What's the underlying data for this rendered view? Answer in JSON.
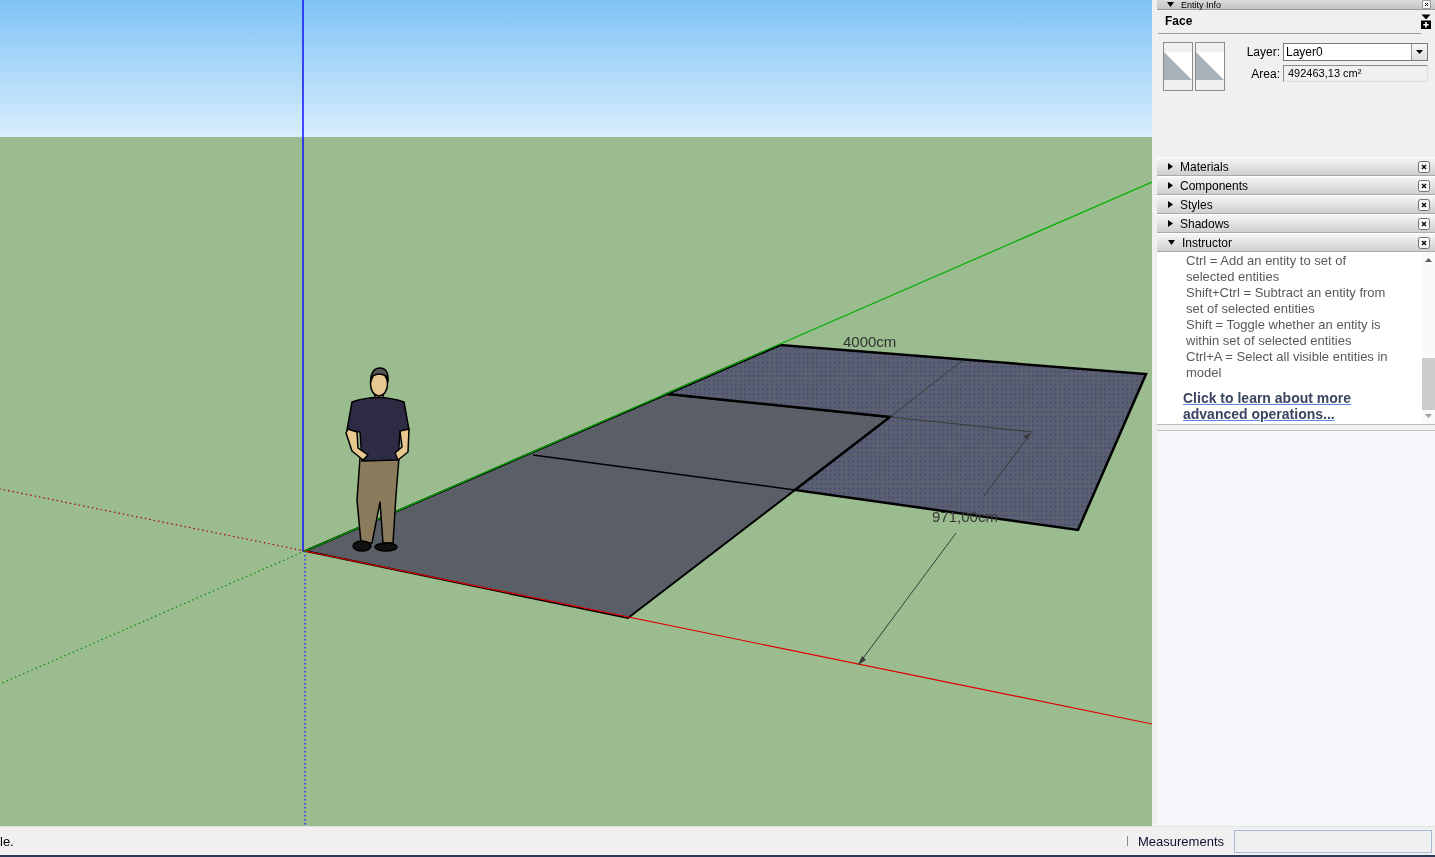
{
  "viewport": {
    "dimension_labels": [
      "4000cm",
      "971,00cm"
    ]
  },
  "entity_info": {
    "title": "Entity Info",
    "expanded": true,
    "entity_type": "Face",
    "layer_label": "Layer:",
    "layer_value": "Layer0",
    "area_label": "Area:",
    "area_value": "492463,13 cm²"
  },
  "trays": [
    {
      "title": "Materials",
      "expanded": false
    },
    {
      "title": "Components",
      "expanded": false
    },
    {
      "title": "Styles",
      "expanded": false
    },
    {
      "title": "Shadows",
      "expanded": false
    },
    {
      "title": "Instructor",
      "expanded": true,
      "content": {
        "lines": [
          "Ctrl = Add an entity to set of selected entities",
          "Shift+Ctrl = Subtract an entity from set of selected entities",
          "Shift = Toggle whether an entity is within set of selected entities",
          "Ctrl+A = Select all visible entities in model"
        ],
        "link": "Click to learn about more advanced operations..."
      }
    }
  ],
  "status_bar": {
    "hint": "le.",
    "measurements_label": "Measurements"
  }
}
